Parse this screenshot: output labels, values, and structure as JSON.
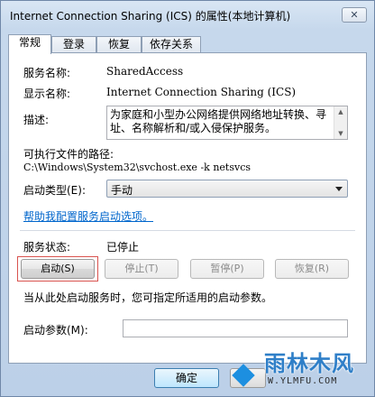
{
  "window": {
    "title": "Internet Connection Sharing (ICS) 的属性(本地计算机)",
    "close_glyph": "✕"
  },
  "tabs": [
    {
      "label": "常规",
      "active": true
    },
    {
      "label": "登录",
      "active": false
    },
    {
      "label": "恢复",
      "active": false
    },
    {
      "label": "依存关系",
      "active": false
    }
  ],
  "general": {
    "service_name_label": "服务名称:",
    "service_name_value": "SharedAccess",
    "display_name_label": "显示名称:",
    "display_name_value": "Internet Connection Sharing (ICS)",
    "description_label": "描述:",
    "description_value": "为家庭和小型办公网络提供网络地址转换、寻址、名称解析和/或入侵保护服务。",
    "exe_path_label": "可执行文件的路径:",
    "exe_path_value": "C:\\Windows\\System32\\svchost.exe -k netsvcs",
    "startup_type_label": "启动类型(E):",
    "startup_type_value": "手动",
    "help_link": "帮助我配置服务启动选项。",
    "service_status_label": "服务状态:",
    "service_status_value": "已停止",
    "buttons": {
      "start": "启动(S)",
      "stop": "停止(T)",
      "pause": "暂停(P)",
      "resume": "恢复(R)"
    },
    "start_params_hint": "当从此处启动服务时，您可指定所适用的启动参数。",
    "start_params_label": "启动参数(M):",
    "start_params_value": ""
  },
  "footer": {
    "ok": "确定"
  },
  "watermark": {
    "main": "雨林木风",
    "sub": "W.YLMFU.COM"
  },
  "colors": {
    "link": "#0066cc",
    "focus_highlight": "#d9534f",
    "watermark": "#2f7fc8"
  }
}
